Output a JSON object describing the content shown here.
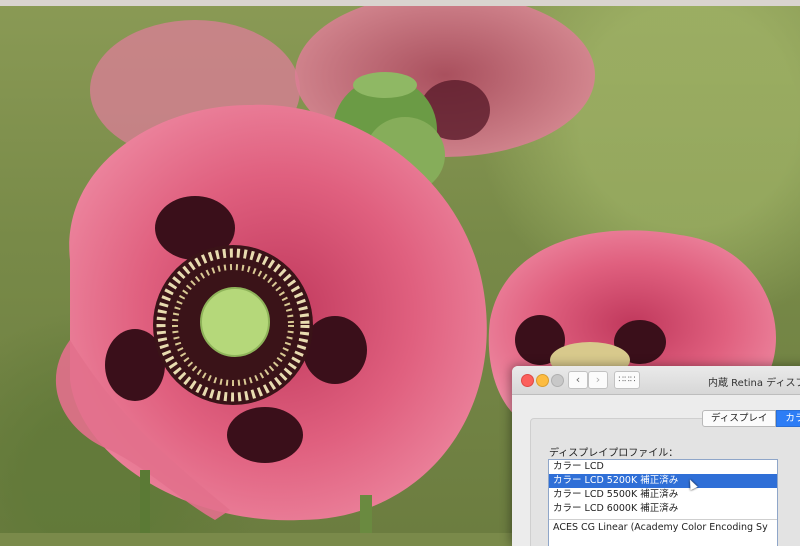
{
  "window": {
    "title": "内蔵 Retina ディスプレ",
    "nav": {
      "back_icon": "‹",
      "forward_icon": "›",
      "grid_icon": "∷∷∷"
    }
  },
  "tabs": [
    {
      "label": "ディスプレイ",
      "selected": false
    },
    {
      "label": "カラ",
      "selected": true
    }
  ],
  "profiles": {
    "label": "ディスプレイプロファイル：",
    "items": [
      {
        "label": "カラー LCD",
        "selected": false
      },
      {
        "label": "カラー LCD 5200K 補正済み",
        "selected": true
      },
      {
        "label": "カラー LCD 5500K 補正済み",
        "selected": false
      },
      {
        "label": "カラー LCD 6000K 補正済み",
        "selected": false
      },
      {
        "label": "ACES CG Linear (Academy Color Encoding Sy",
        "selected": false
      }
    ]
  },
  "colors": {
    "selection": "#2f6fd7",
    "tab_selected": "#2d7df6",
    "close": "#fc605c",
    "minimize": "#fdbc40"
  }
}
